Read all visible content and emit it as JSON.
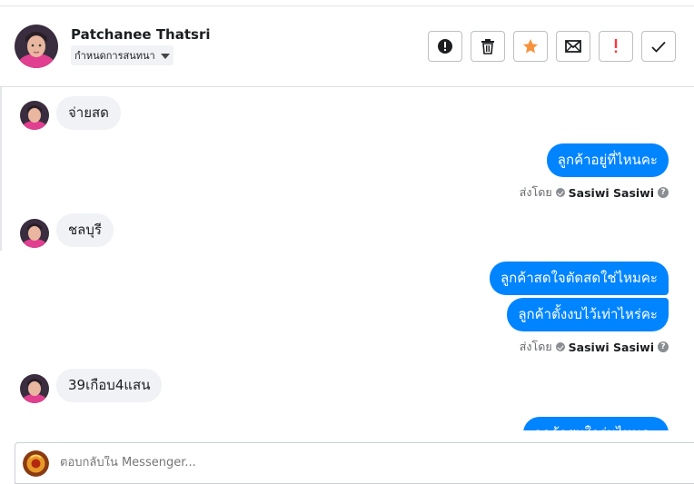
{
  "header": {
    "contact_name": "Patchanee Thatsri",
    "label_select": "กำหนดการสนทนา",
    "actions": [
      {
        "icon": "exclamation-circle-icon",
        "name": "report-spam-button"
      },
      {
        "icon": "trash-icon",
        "name": "delete-button"
      },
      {
        "icon": "star-icon",
        "name": "star-button",
        "color": "#f7923b"
      },
      {
        "icon": "envelope-icon",
        "name": "mark-unread-button"
      },
      {
        "icon": "exclamation-icon",
        "name": "follow-up-button",
        "color": "#fa383e"
      },
      {
        "icon": "checkmark-icon",
        "name": "mark-done-button"
      }
    ]
  },
  "messages": {
    "m1": "จ่ายสด",
    "m2": "ลูกค้าอยู่ที่ไหนคะ",
    "m3": "ชลบุรี",
    "m4": "ลูกค้าสดใจตัดสดใช่ไหมคะ",
    "m5": "ลูกค้าตั้งงบไว้เท่าไหร่คะ",
    "m6": "39เกือบ4แสน",
    "m7": "ลูกค้าสนใจรุ่นไหนคะ"
  },
  "sent_by": {
    "label": "ส่งโดย",
    "name": "Sasiwi Sasiwi"
  },
  "composer": {
    "placeholder": "ตอบกลับใน Messenger..."
  },
  "colors": {
    "outgoing_bubble": "#0084ff",
    "incoming_bubble": "#f0f2f5",
    "star": "#f7923b",
    "alert": "#fa383e"
  }
}
